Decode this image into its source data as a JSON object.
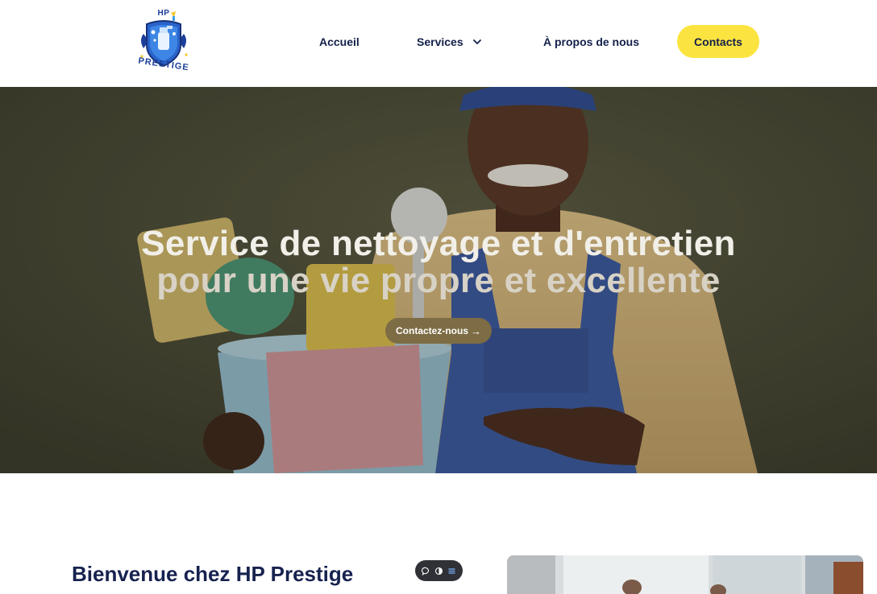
{
  "brand": {
    "logo_top": "HP",
    "logo_word": "PRESTIGE",
    "colors": {
      "primary": "#1b3f9a",
      "accent": "#fbe43f",
      "text": "#14204a"
    }
  },
  "nav": {
    "items": [
      {
        "label": "Accueil"
      },
      {
        "label": "Services",
        "icon": "chevron-down-icon"
      },
      {
        "label": "À propos de nous"
      }
    ],
    "contacts_label": "Contacts"
  },
  "hero": {
    "title_line1": "Service de nettoyage et d'entretien",
    "title_line2": "pour une vie propre et excellente",
    "cta_label": "Contactez-nous",
    "cta_icon": "arrow-right-icon"
  },
  "welcome": {
    "title": "Bienvenue chez HP Prestige"
  },
  "toolbar": {
    "icons": [
      "comment-icon",
      "toggle-icon",
      "menu-lines-icon"
    ]
  }
}
